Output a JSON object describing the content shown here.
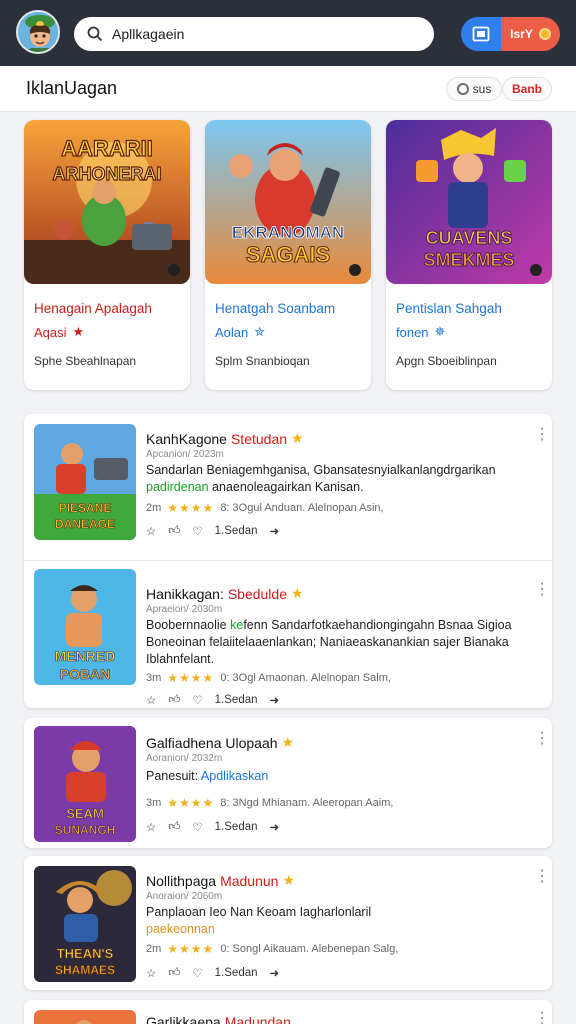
{
  "topbar": {
    "search_text": "Apllkagaein",
    "actions": {
      "red_button_label": "IsrY"
    },
    "colors": {
      "bar": "#2b303b",
      "blue": "#2f80ed",
      "red": "#ec5d48"
    }
  },
  "header": {
    "title": "IklanUagan",
    "chips": {
      "status": "sus",
      "save": "Banb"
    }
  },
  "featured": [
    {
      "art_text": "AARARII ARHONERAI",
      "title": "Henagain Apalagah",
      "sub": "Aqasi",
      "meta": "Sphe Sbeahlnapan",
      "title_color": "red"
    },
    {
      "art_text": "EKRANOMAN SAGAIS",
      "title": "Henatgah Soanbam",
      "sub": "Aolan",
      "meta": "Splm Snanbioqan",
      "title_color": "blue"
    },
    {
      "art_text": "CUAVENS SMEKMES",
      "title": "Pentislan Sahgah",
      "sub": "fonen",
      "meta": "Apgn Sboeiblinpan",
      "title_color": "blue"
    }
  ],
  "list": [
    {
      "thumb_text": "PIESANE DANEAGE",
      "title_a": "KanhKagone",
      "title_b": "Stetudan",
      "sub": "Apcanion/ 2023m",
      "desc_a": "Sandarlan Beniagemhganisa, Gbansatesnyialkanlangdrgarikan ",
      "desc_green": "padirdenan",
      "desc_b": " anaenoleagairkan Kanisan.",
      "stats_a": "2m",
      "stars": "★★★★",
      "stats_b": "8: 3Ogul Anduan. Alelnopan Asin,",
      "actions_label": "1.Sedan"
    },
    {
      "thumb_text": "MENRED POBAN",
      "title_a": "Hanikkagan:",
      "title_b": "Sbedulde",
      "sub": "Apraeion/ 2030m",
      "desc_a": "Boobernnaolie ",
      "desc_green": "ke",
      "desc_b": "fenn Sandarfotkaehandiongingahn Bsnaa Sigioa Boneoinan felaiitelaaenlankan; Naniaeaskanankian sajer Bianaka Iblahnfelant.",
      "stats_a": "3m",
      "stars": "★★★★",
      "stats_b": "0: 3Ogl Amaonan. Alelnopan Salm,",
      "actions_label": "1.Sedan"
    },
    {
      "thumb_text": "SEAM SUNANGH",
      "title_a": "Galfiadhena Ulopaah",
      "title_b": "",
      "sub": "Aoranion/ 2032m",
      "desc_a": "Panesuit: ",
      "desc_blue": "Apdlikaskan",
      "stats_a": "3m",
      "stars": "★★★★",
      "stats_b": "8: 3Ngd Mhianam. Aleeropan Aaim,",
      "actions_label": "1.Sedan"
    },
    {
      "thumb_text": "THEAN'S SHAMAES",
      "title_a": "Nollithpaga",
      "title_b": "Madunun",
      "sub": "Anoraion/ 2060m",
      "desc_a": "Panplaoan Ieo Nan Keoam Iagharlonlaril",
      "desc_orange": "paekeonnan",
      "stats_a": "2m",
      "stars": "★★★★",
      "stats_b": "0: Songl Aikauam. Alebenepan Salg,",
      "actions_label": "1.Sedan"
    },
    {
      "title_a": "Garlikkaepa",
      "title_b": "Madundan"
    }
  ]
}
